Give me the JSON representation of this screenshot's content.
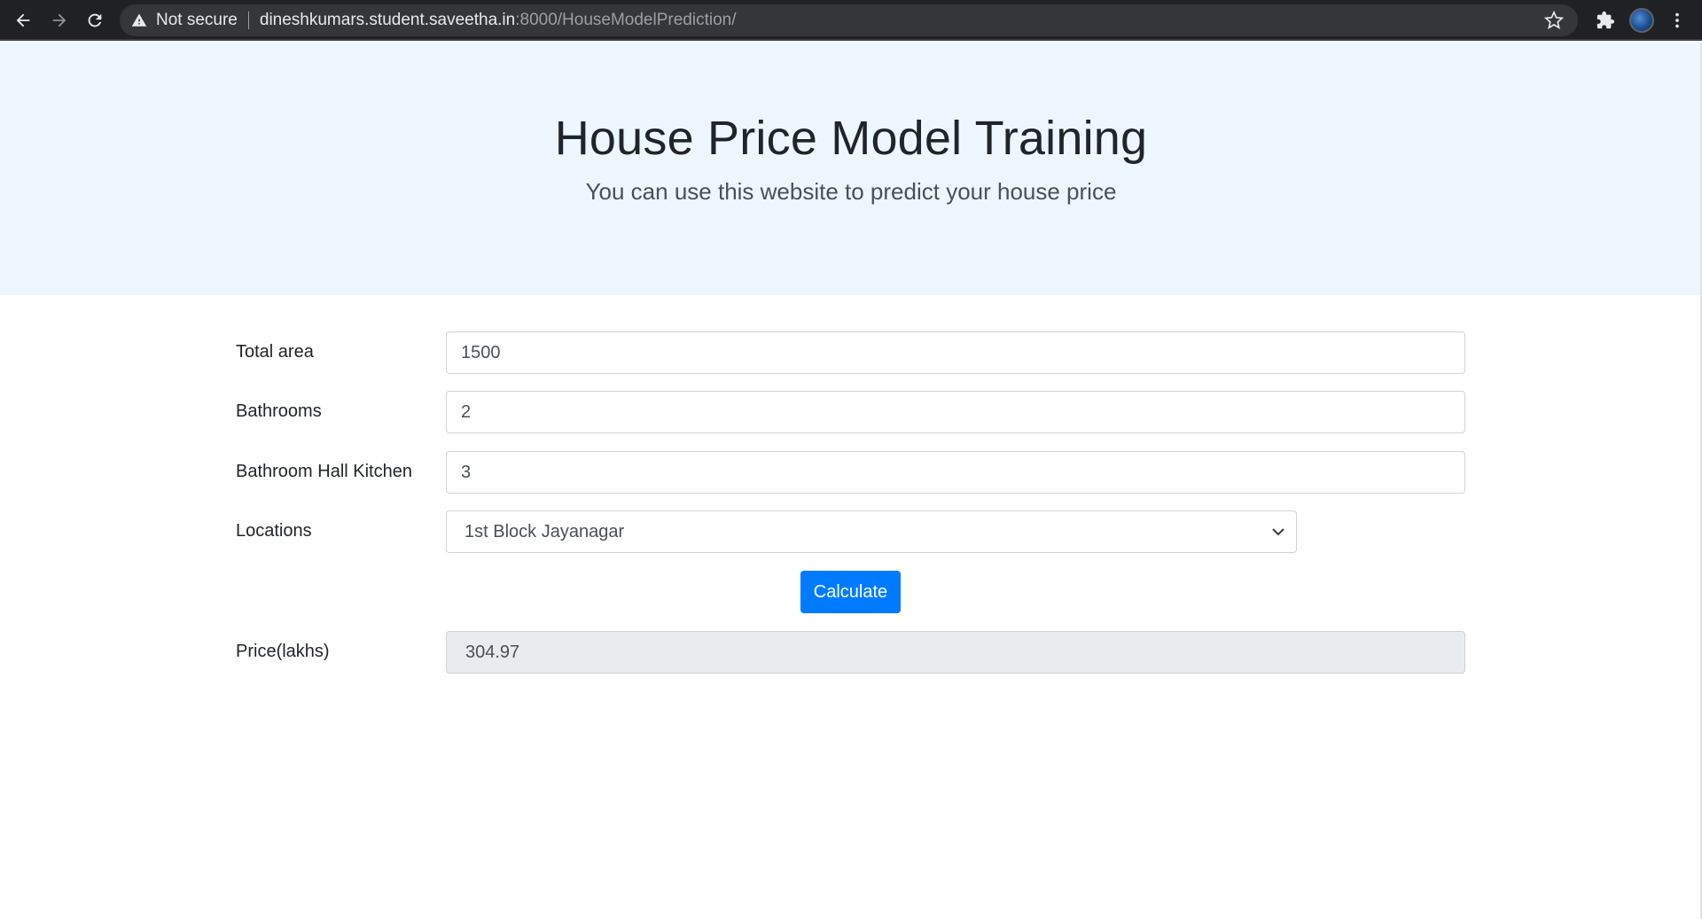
{
  "browser": {
    "security_label": "Not secure",
    "url_host": "dineshkumars.student.saveetha.in",
    "url_rest": ":8000/HouseModelPrediction/"
  },
  "header": {
    "title": "House Price Model Training",
    "subtitle": "You can use this website to predict your house price"
  },
  "form": {
    "total_area": {
      "label": "Total area",
      "value": "1500"
    },
    "bathrooms": {
      "label": "Bathrooms",
      "value": "2"
    },
    "bhk": {
      "label": "Bathroom Hall Kitchen",
      "value": "3"
    },
    "locations": {
      "label": "Locations",
      "selected": "1st Block Jayanagar"
    },
    "calculate_label": "Calculate",
    "price": {
      "label": "Price(lakhs)",
      "value": "304.97"
    }
  },
  "colors": {
    "primary": "#007bff",
    "jumbotron_bg": "#eef7ff",
    "readonly_bg": "#e9ecef"
  }
}
